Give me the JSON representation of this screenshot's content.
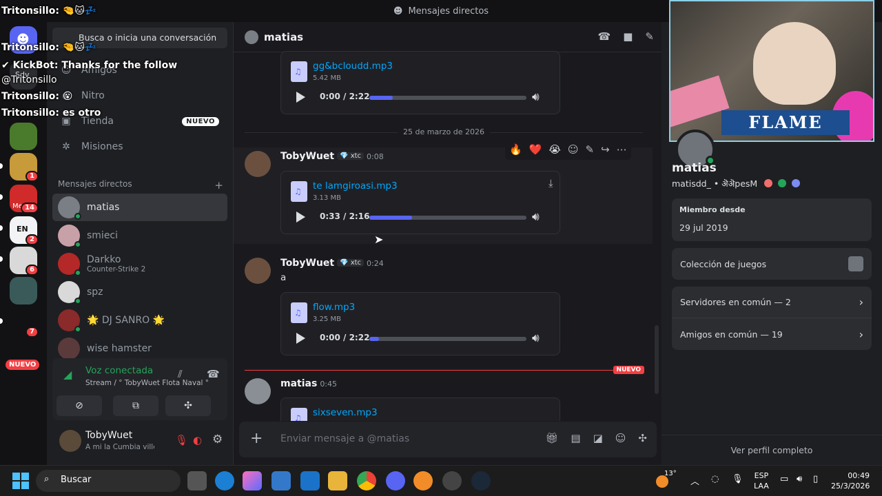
{
  "title": "Mensajes directos",
  "sidebar": {
    "search_placeholder": "Busca o inicia una conversación",
    "nav": [
      "Amigos",
      "Nitro",
      "Tienda",
      "Misiones"
    ],
    "new_badge": "NUEVO",
    "dm_section": "Mensajes directos",
    "dms": [
      {
        "name": "matias",
        "sub": ""
      },
      {
        "name": "smieci",
        "sub": ""
      },
      {
        "name": "Darkko",
        "sub": "Counter-Strike 2"
      },
      {
        "name": "spz",
        "sub": ""
      },
      {
        "name": "🌟 DJ SANRO 🌟",
        "sub": ""
      },
      {
        "name": "wise hamster",
        "sub": ""
      }
    ],
    "voice_title": "Voz conectada",
    "voice_sub": "Stream / ° TobyWuet Flota Naval °",
    "user_name": "TobyWuet",
    "user_status": "A mi la Cumbia villera"
  },
  "rail": {
    "badges": [
      "1",
      "14",
      "2",
      "6",
      "7"
    ],
    "new_label": "NUEVO",
    "server_label_1": "Sdv",
    "server_label_2": "EN",
    "server_label_3": "Me"
  },
  "chat": {
    "recipient": "matias",
    "date_divider": "25 de marzo de 2026",
    "new_divider": "NUEVO",
    "messages": [
      {
        "author": "",
        "file": "gg&bcloudd.mp3",
        "size": "5.42 MB",
        "time_display": "0:00 / 2:22",
        "progress": 0.15
      },
      {
        "author": "TobyWuet",
        "tag": "💎 xtc",
        "time": "0:08",
        "file": "te lamgiroasi.mp3",
        "size": "3.13 MB",
        "time_display": "0:33 / 2:16",
        "progress": 0.27
      },
      {
        "author": "TobyWuet",
        "tag": "💎 xtc",
        "time": "0:24",
        "text": "a",
        "file": "flow.mp3",
        "size": "3.25 MB",
        "time_display": "0:00 / 2:22",
        "progress": 0.06
      },
      {
        "author": "matias",
        "time": "0:45",
        "file": "sixseven.mp3"
      }
    ],
    "reactions": [
      "🔥",
      "❤️",
      "😭",
      "☺",
      "✎",
      "↪",
      "⋯"
    ],
    "composer_placeholder": "Enviar mensaje a @matias"
  },
  "profile": {
    "name": "matias",
    "username": "matisdd_ • ऄऄpesM",
    "banner_text": "FLAME",
    "member_since_label": "Miembro desde",
    "member_since": "29 jul 2019",
    "games_label": "Colección de juegos",
    "servers_label": "Servidores en común — 2",
    "friends_label": "Amigos en común — 19",
    "full_profile": "Ver perfil completo"
  },
  "overlay": [
    "Tritonsillo: 🤏🐱💤",
    "Tritonsillo: 🤏🐱💤",
    "✔ KickBot: Thanks for the follow",
    "@Tritonsillo",
    "Tritonsillo: 😮",
    "Tritonsillo: es otro"
  ],
  "taskbar": {
    "search": "Buscar",
    "weather": "13°",
    "lang1": "ESP",
    "lang2": "LAA",
    "time": "00:49",
    "date": "25/3/2026"
  },
  "colors": {
    "accent": "#5865f2",
    "online": "#23a55a",
    "danger": "#f23f43",
    "link": "#00a8fc"
  }
}
